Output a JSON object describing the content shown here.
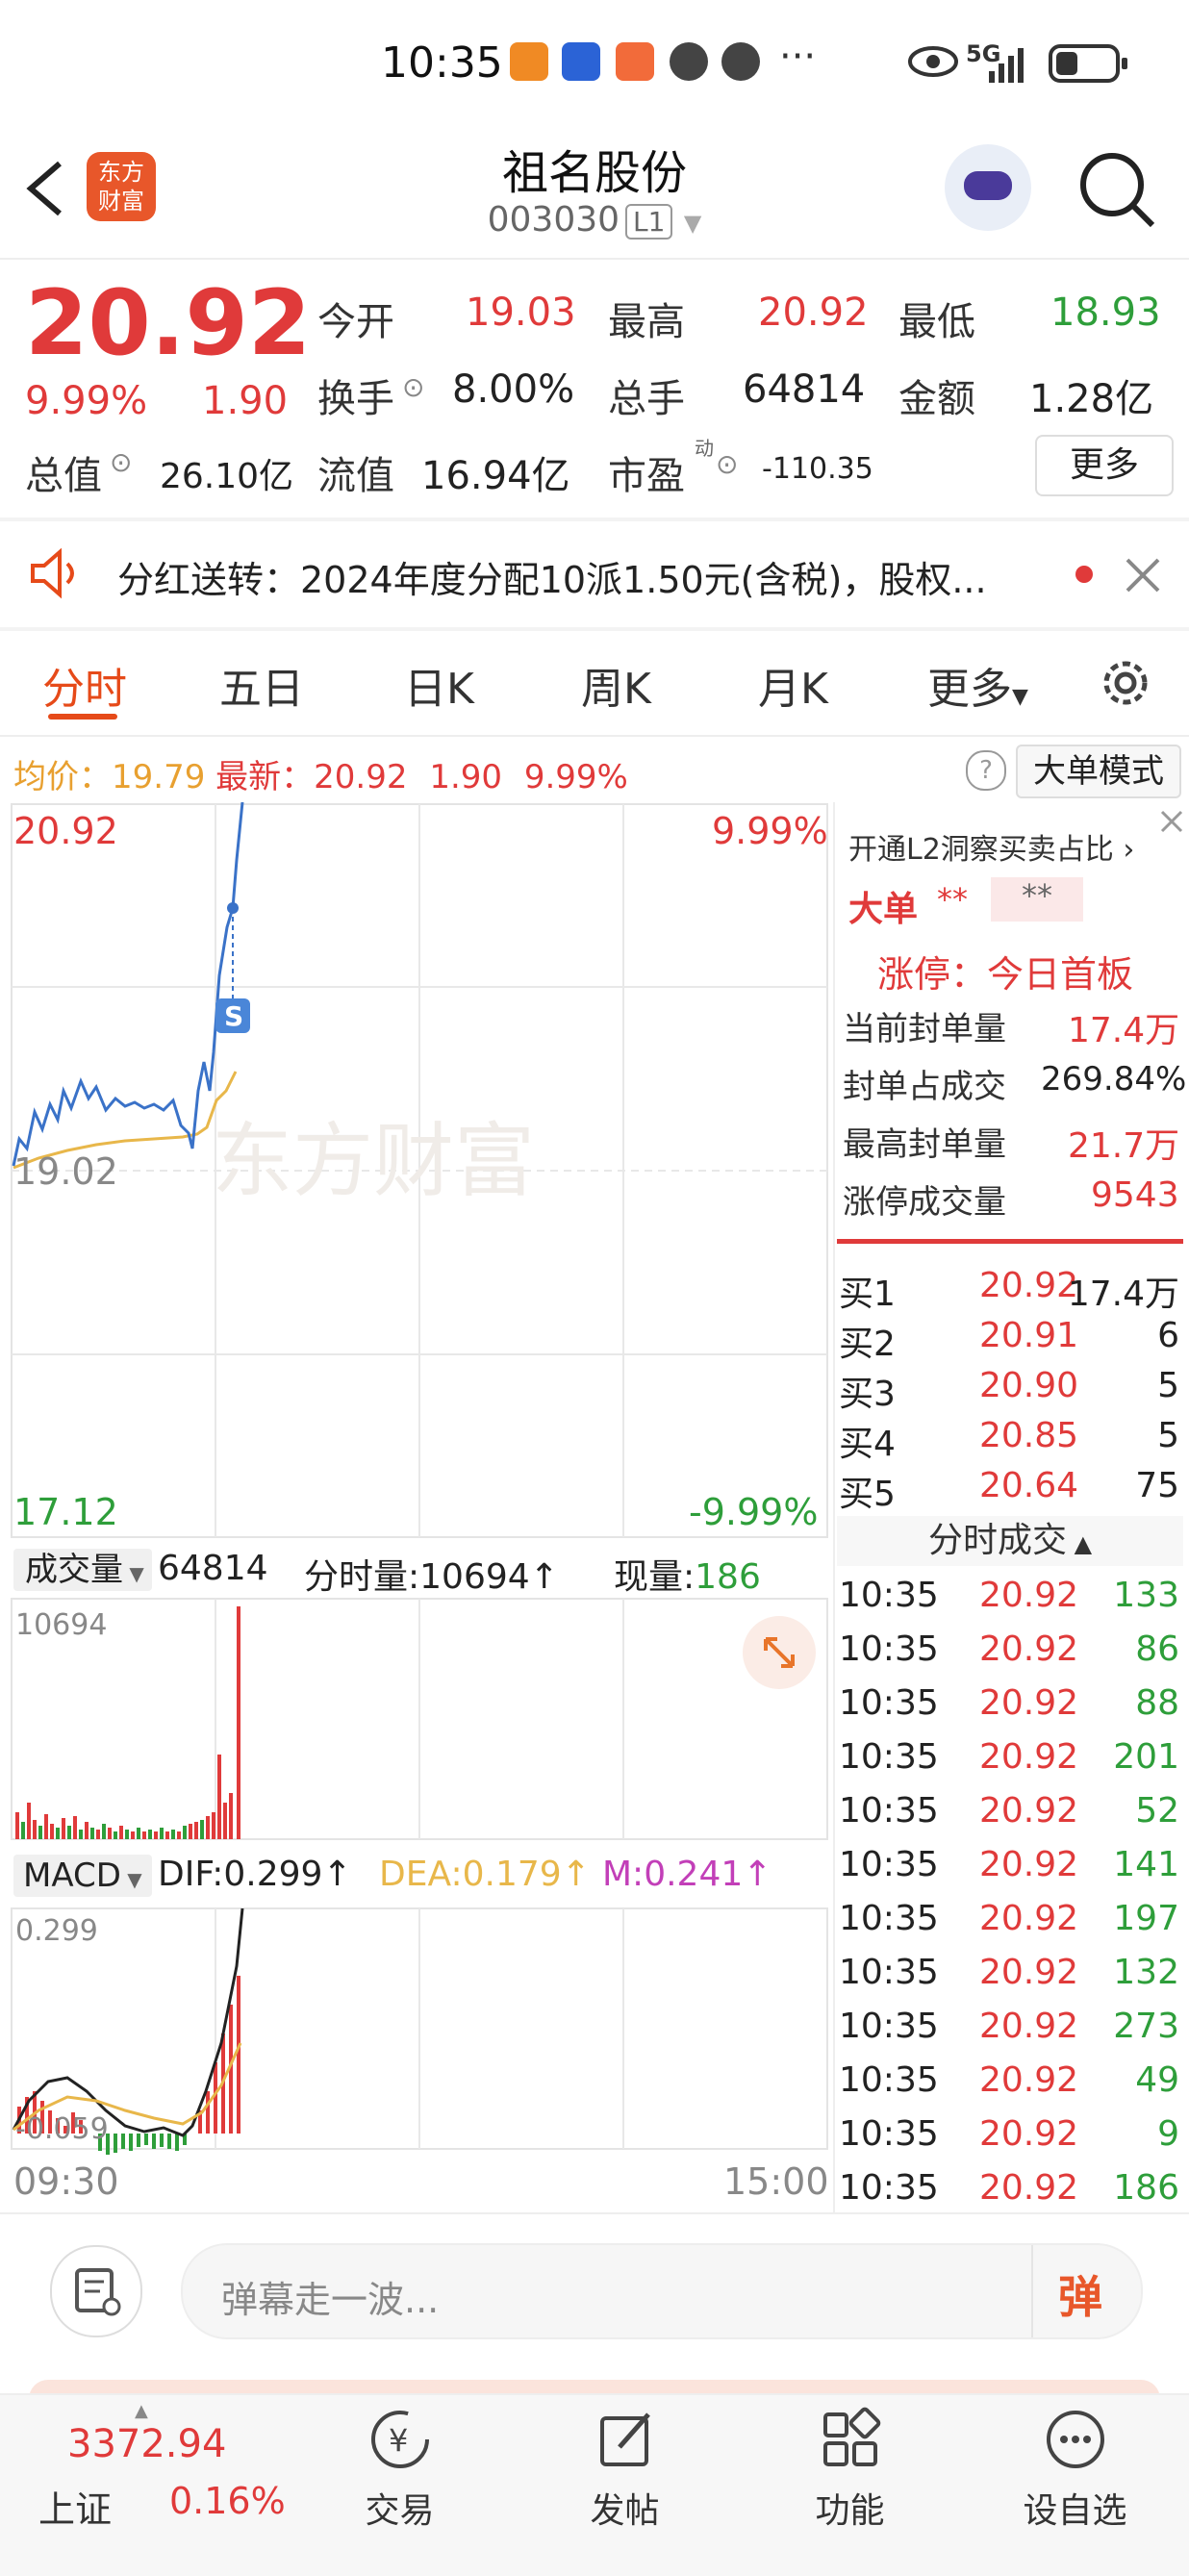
{
  "status_bar": {
    "time": "10:35",
    "network": "5G"
  },
  "header": {
    "logo": "东方\n财富",
    "stock_name": "祖名股份",
    "stock_code": "003030",
    "level": "L1"
  },
  "quote": {
    "price": "20.92",
    "change_pct": "9.99%",
    "change": "1.90",
    "open_label": "今开",
    "open": "19.03",
    "high_label": "最高",
    "high": "20.92",
    "low_label": "最低",
    "low": "18.93",
    "turnover_label": "换手",
    "turnover": "8.00%",
    "volume_label": "总手",
    "volume": "64814",
    "amount_label": "金额",
    "amount": "1.28亿",
    "mktcap_label": "总值",
    "mktcap": "26.10亿",
    "float_label": "流值",
    "float": "16.94亿",
    "pe_label": "市盈",
    "pe_sup": "动",
    "pe": "-110.35",
    "more_label": "更多"
  },
  "notice": {
    "text": "分红送转：2024年度分配10派1.50元(含税)，股权..."
  },
  "tabs": [
    "分时",
    "五日",
    "日K",
    "周K",
    "月K",
    "更多"
  ],
  "info_bar": {
    "avg_label": "均价：",
    "avg": "19.79",
    "latest_label": "最新：",
    "latest": "20.92",
    "change": "1.90",
    "change_pct": "9.99%",
    "big_order_mode": "大单模式"
  },
  "chart_labels": {
    "top_price": "20.92",
    "top_pct": "9.99%",
    "mid_price": "19.02",
    "bottom_price": "17.12",
    "bottom_pct": "-9.99%",
    "s_marker": "S",
    "watermark": "东方财富"
  },
  "volume_bar": {
    "label": "成交量",
    "total": "64814",
    "period_label": "分时量:",
    "period": "10694",
    "now_label": "现量:",
    "now": "186",
    "max_tick": "10694"
  },
  "macd": {
    "label": "MACD",
    "dif": "DIF:0.299",
    "dea": "DEA:0.179",
    "m": "M:0.241",
    "top_tick": "0.299",
    "bottom_tick": "-0.059"
  },
  "time_axis": {
    "start": "09:30",
    "end": "15:00"
  },
  "side_panel": {
    "promo": "开通L2洞察买卖占比",
    "big_order_label": "大单",
    "big_order_val1": "**",
    "big_order_val2": "**",
    "limit_up_label": "涨停：今日首板",
    "seal_qty_label": "当前封单量",
    "seal_qty": "17.4万",
    "seal_ratio_label": "封单占成交",
    "seal_ratio": "269.84%",
    "max_seal_label": "最高封单量",
    "max_seal": "21.7万",
    "limit_vol_label": "涨停成交量",
    "limit_vol": "9543"
  },
  "order_book": [
    {
      "label": "买1",
      "price": "20.92",
      "qty": "17.4万"
    },
    {
      "label": "买2",
      "price": "20.91",
      "qty": "6"
    },
    {
      "label": "买3",
      "price": "20.90",
      "qty": "5"
    },
    {
      "label": "买4",
      "price": "20.85",
      "qty": "5"
    },
    {
      "label": "买5",
      "price": "20.64",
      "qty": "75"
    }
  ],
  "ticks_header": "分时成交",
  "ticks": [
    {
      "time": "10:35",
      "price": "20.92",
      "qty": "133"
    },
    {
      "time": "10:35",
      "price": "20.92",
      "qty": "86"
    },
    {
      "time": "10:35",
      "price": "20.92",
      "qty": "88"
    },
    {
      "time": "10:35",
      "price": "20.92",
      "qty": "201"
    },
    {
      "time": "10:35",
      "price": "20.92",
      "qty": "52"
    },
    {
      "time": "10:35",
      "price": "20.92",
      "qty": "141"
    },
    {
      "time": "10:35",
      "price": "20.92",
      "qty": "197"
    },
    {
      "time": "10:35",
      "price": "20.92",
      "qty": "132"
    },
    {
      "time": "10:35",
      "price": "20.92",
      "qty": "273"
    },
    {
      "time": "10:35",
      "price": "20.92",
      "qty": "49"
    },
    {
      "time": "10:35",
      "price": "20.92",
      "qty": "9"
    },
    {
      "time": "10:35",
      "price": "20.92",
      "qty": "186"
    }
  ],
  "comment_bar": {
    "placeholder": "弹幕走一波...",
    "danmu_button": "弹"
  },
  "bottom_nav": {
    "index_value": "3372.94",
    "index_name": "上证",
    "index_pct": "0.16%",
    "items": [
      "交易",
      "发帖",
      "功能",
      "设自选"
    ]
  },
  "colors": {
    "up": "#e03a3a",
    "down": "#2e9e3a",
    "accent": "#e64a19",
    "avg_line": "#e8b74a"
  }
}
